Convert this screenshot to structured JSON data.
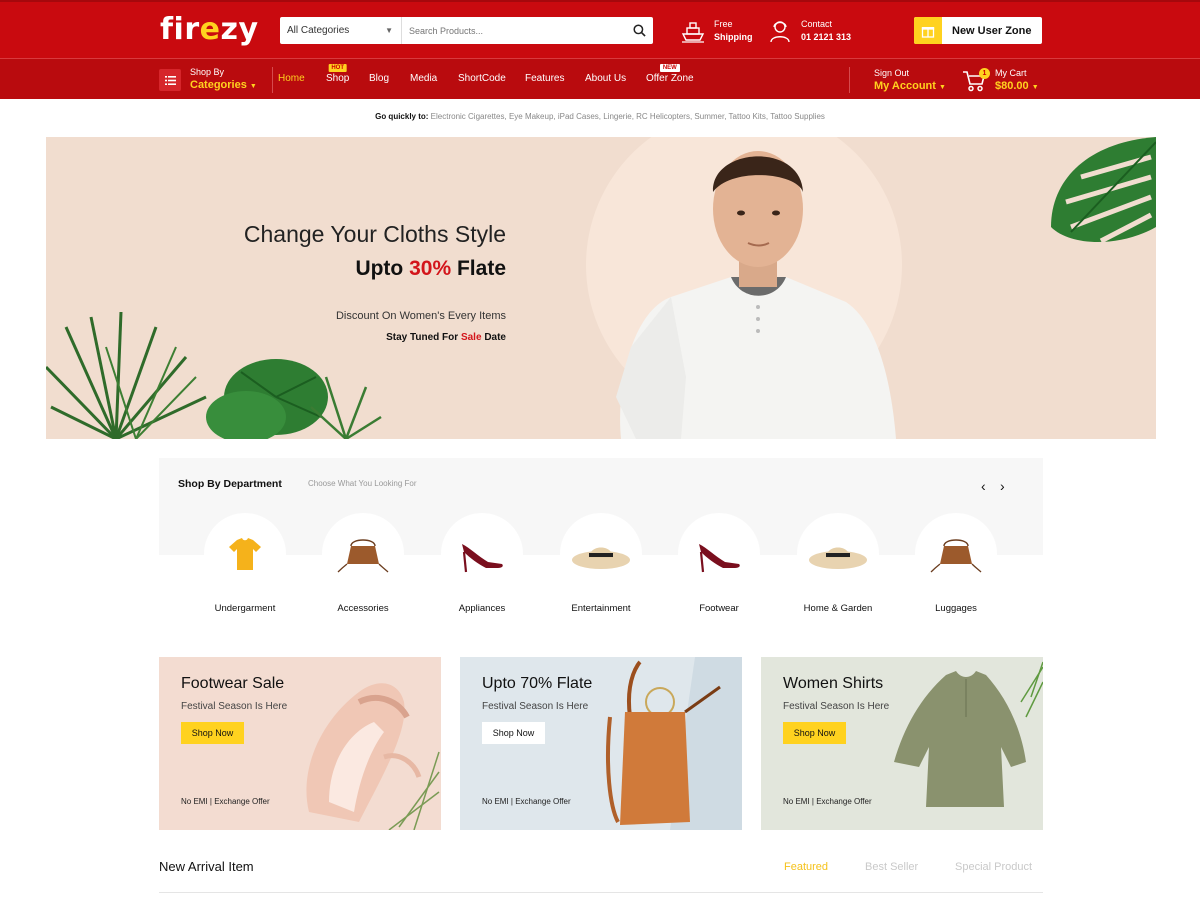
{
  "header": {
    "logo": {
      "text_pre": "fir",
      "text_accent": "e",
      "text_post": "zy"
    },
    "search": {
      "category": "All Categories",
      "placeholder": "Search Products..."
    },
    "shipping": {
      "line1": "Free",
      "line2": "Shipping"
    },
    "contact": {
      "line1": "Contact",
      "line2": "01 2121 313"
    },
    "new_user": "New User Zone"
  },
  "nav": {
    "shop_by": {
      "line1": "Shop By",
      "line2": "Categories"
    },
    "items": [
      {
        "label": "Home",
        "active": true
      },
      {
        "label": "Shop",
        "badge": "HOT"
      },
      {
        "label": "Blog"
      },
      {
        "label": "Media"
      },
      {
        "label": "ShortCode"
      },
      {
        "label": "Features"
      },
      {
        "label": "About Us"
      },
      {
        "label": "Offer Zone",
        "badge": "NEW"
      }
    ],
    "account": {
      "line1": "Sign Out",
      "line2": "My Account"
    },
    "cart": {
      "line1": "My Cart",
      "line2": "$80.00",
      "count": "1"
    }
  },
  "quick_links": {
    "label": "Go quickly to:",
    "links": [
      "Electronic Cigarettes",
      "Eye Makeup",
      "iPad Cases",
      "Lingerie",
      "RC Helicopters",
      "Summer",
      "Tattoo Kits",
      "Tattoo Supplies"
    ]
  },
  "hero": {
    "title": "Change Your Cloths Style",
    "subtitle_pre": "Upto",
    "subtitle_accent": "30%",
    "subtitle_post": "Flate",
    "line1": "Discount On Women's Every Items",
    "line2_pre": "Stay Tuned For",
    "line2_accent": "Sale",
    "line2_post": "Date"
  },
  "department": {
    "title": "Shop By Department",
    "subtitle": "Choose What You Looking For",
    "categories": [
      {
        "name": "Undergarment",
        "icon": "tshirt-icon"
      },
      {
        "name": "Accessories",
        "icon": "bag-icon"
      },
      {
        "name": "Appliances",
        "icon": "heel-icon"
      },
      {
        "name": "Entertainment",
        "icon": "hat-icon"
      },
      {
        "name": "Footwear",
        "icon": "heel-icon"
      },
      {
        "name": "Home & Garden",
        "icon": "hat-icon"
      },
      {
        "name": "Luggages",
        "icon": "bag-icon"
      }
    ]
  },
  "promos": [
    {
      "title": "Footwear Sale",
      "subtitle": "Festival Season Is Here",
      "button": "Shop Now",
      "note": "No EMI | Exchange Offer",
      "bg": "#f3dcd1",
      "btn_bg": "#ffd21f"
    },
    {
      "title": "Upto 70% Flate",
      "subtitle": "Festival Season Is Here",
      "button": "Shop Now",
      "note": "No EMI | Exchange Offer",
      "bg": "#dfe7ec",
      "btn_bg": "#ffffff"
    },
    {
      "title": "Women Shirts",
      "subtitle": "Festival Season Is Here",
      "button": "Shop Now",
      "note": "No EMI | Exchange Offer",
      "bg": "#e2e6dc",
      "btn_bg": "#ffd21f"
    }
  ],
  "arrivals": {
    "title": "New Arrival Item",
    "tabs": [
      "Featured",
      "Best Seller",
      "Special Product"
    ]
  },
  "colors": {
    "primary": "#c90a0f",
    "accent": "#ffd21f"
  }
}
